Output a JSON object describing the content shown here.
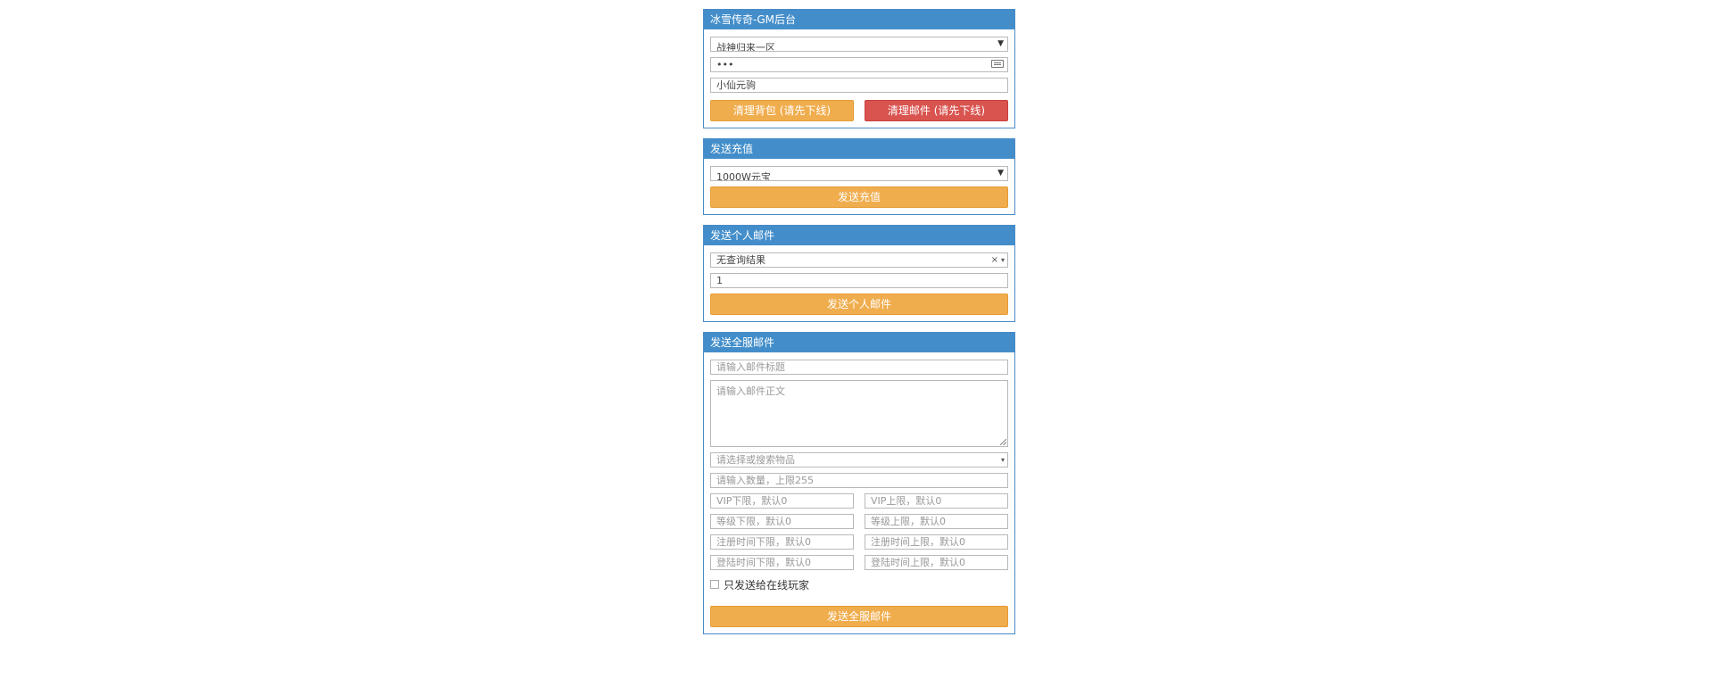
{
  "panel1": {
    "title": "冰雪传奇-GM后台",
    "server_select": "战神归来一区",
    "password_value": "•••",
    "role_input": "小仙元驹",
    "clear_bag_button": "清理背包 (请先下线)",
    "clear_mail_button": "清理邮件 (请先下线)"
  },
  "panel2": {
    "title": "发送充值",
    "amount_select": "1000W元宝",
    "send_button": "发送充值"
  },
  "panel3": {
    "title": "发送个人邮件",
    "item_search": "无查询结果",
    "quantity_value": "1",
    "send_button": "发送个人邮件"
  },
  "panel4": {
    "title": "发送全服邮件",
    "mail_title_placeholder": "请输入邮件标题",
    "mail_body_placeholder": "请输入邮件正文",
    "item_select_placeholder": "请选择或搜索物品",
    "quantity_placeholder": "请输入数量，上限255",
    "vip_min_placeholder": "VIP下限，默认0",
    "vip_max_placeholder": "VIP上限，默认0",
    "level_min_placeholder": "等级下限，默认0",
    "level_max_placeholder": "等级上限，默认0",
    "reg_min_placeholder": "注册时间下限，默认0",
    "reg_max_placeholder": "注册时间上限，默认0",
    "login_min_placeholder": "登陆时间下限，默认0",
    "login_max_placeholder": "登陆时间上限，默认0",
    "online_only_label": "只发送给在线玩家",
    "send_button": "发送全服邮件"
  },
  "colors": {
    "header_blue": "#438eca",
    "warning_orange": "#f0ad4e",
    "danger_red": "#d9534f"
  },
  "icons": {
    "dropdown": "caret-down-icon",
    "keyboard": "keyboard-icon",
    "clear": "clear-icon"
  }
}
